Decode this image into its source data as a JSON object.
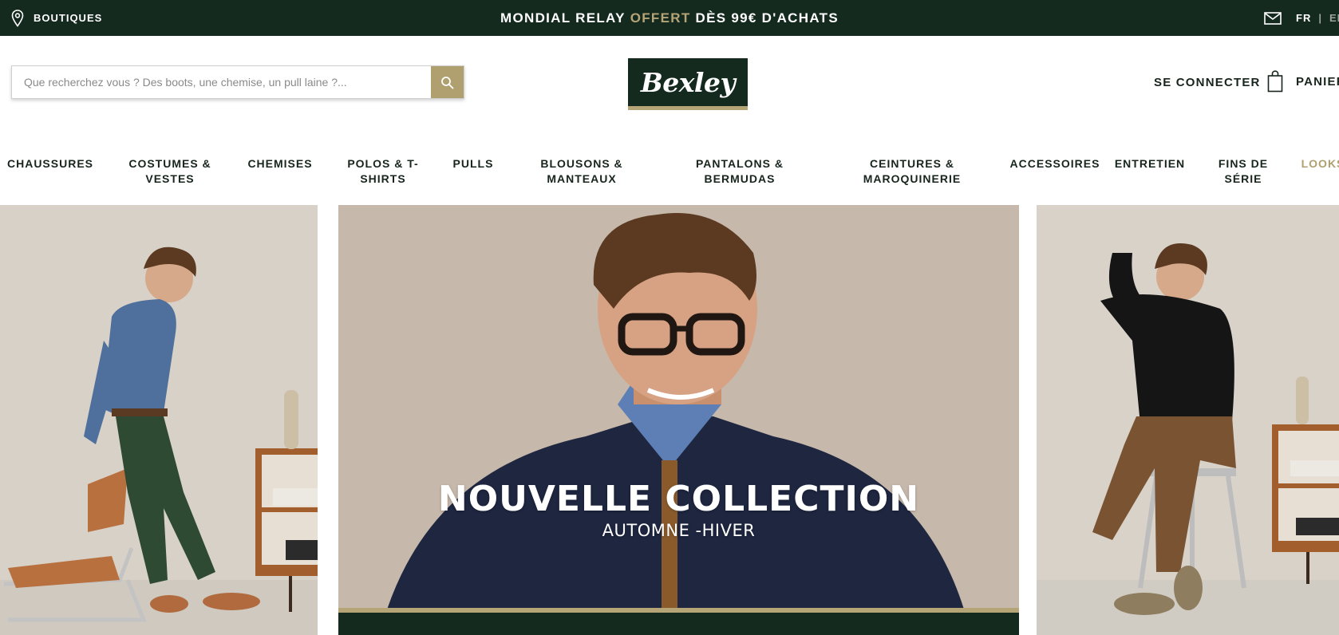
{
  "topbar": {
    "stores_label": "BOUTIQUES",
    "promo_before": "MONDIAL RELAY",
    "promo_highlight": "OFFERT",
    "promo_after": "DÈS 99€ D'ACHATS",
    "lang_fr": "FR",
    "lang_sep": "|",
    "lang_en": "EN"
  },
  "header": {
    "search_placeholder": "Que recherchez vous ? Des boots, une chemise, un pull laine ?...",
    "logo_text": "Bexley",
    "login_label": "SE CONNECTER",
    "cart_label": "PANIER"
  },
  "nav": {
    "items": [
      {
        "label": "CHAUSSURES"
      },
      {
        "label": "COSTUMES &\nVESTES"
      },
      {
        "label": "CHEMISES"
      },
      {
        "label": "POLOS & T-\nSHIRTS"
      },
      {
        "label": "PULLS"
      },
      {
        "label": "BLOUSONS &\nMANTEAUX"
      },
      {
        "label": "PANTALONS &\nBERMUDAS"
      },
      {
        "label": "CEINTURES &\nMAROQUINERIE"
      },
      {
        "label": "ACCESSOIRES"
      },
      {
        "label": "ENTRETIEN"
      },
      {
        "label": "FINS DE\nSÉRIE"
      },
      {
        "label": "LOOKS"
      }
    ]
  },
  "hero": {
    "title": "NOUVELLE COLLECTION",
    "subtitle": "AUTOMNE -HIVER"
  },
  "colors": {
    "brand_dark": "#142a1f",
    "brand_gold": "#b5a476",
    "search_button": "#b09f6f",
    "photo_background": "#c9bcae"
  },
  "icons": {
    "stores": "location-pin-icon",
    "newsletter": "mail-icon",
    "search": "search-icon",
    "cart": "shopping-bag-icon"
  }
}
